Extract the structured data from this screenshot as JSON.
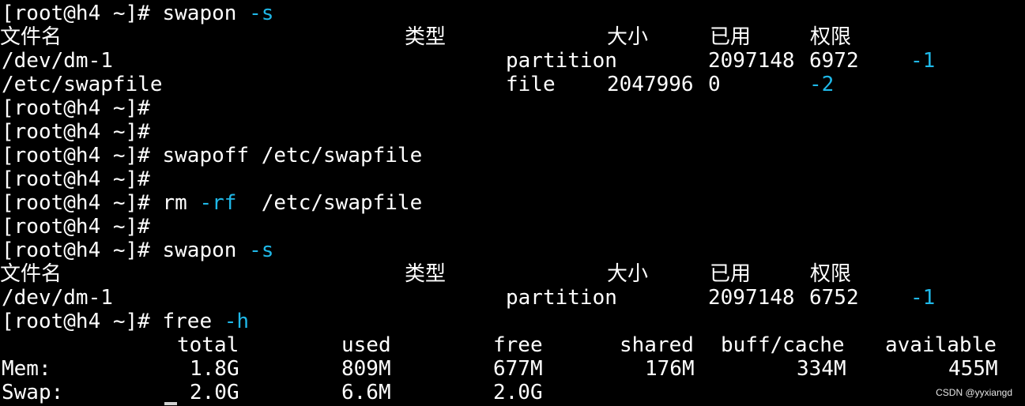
{
  "terminal": {
    "prompt": "[root@h4 ~]# ",
    "swapon_cmd_1": {
      "cmd": "swapon",
      "flag": "-s"
    },
    "swapon_header": {
      "name": "文件名",
      "type": "类型",
      "size": "大小",
      "used": "已用",
      "priority": "权限"
    },
    "swap_row_dm1_a": {
      "name": "/dev/dm-1",
      "type": "partition",
      "size": "2097148",
      "used": "6972",
      "priority": "-1"
    },
    "swap_row_file": {
      "name": "/etc/swapfile",
      "type": "file",
      "size": "2047996",
      "used": "0",
      "priority": "-2"
    },
    "swapoff_cmd": {
      "text": "swapoff /etc/swapfile"
    },
    "rm_cmd": {
      "cmd": "rm",
      "flag": "-rf",
      "arg": "/etc/swapfile"
    },
    "swapon_cmd_2": {
      "cmd": "swapon",
      "flag": "-s"
    },
    "swap_row_dm1_b": {
      "name": "/dev/dm-1",
      "type": "partition",
      "size": "2097148",
      "used": "6752",
      "priority": "-1"
    },
    "free_cmd": {
      "cmd": "free",
      "flag": "-h"
    },
    "free_header": {
      "total": "total",
      "used": "used",
      "free": "free",
      "shared": "shared",
      "buff_cache": "buff/cache",
      "available": "available"
    },
    "free_mem": {
      "label": "Mem:",
      "total": "1.8G",
      "used": "809M",
      "free": "677M",
      "shared": "176M",
      "buff_cache": "334M",
      "available": "455M"
    },
    "free_swap": {
      "label": "Swap:",
      "total": "2.0G",
      "used": "6.6M",
      "free": "2.0G"
    }
  },
  "watermark": "CSDN @yyxiangd",
  "colors": {
    "background": "#000000",
    "text": "#ffffff",
    "option": "#1fb8e8"
  }
}
